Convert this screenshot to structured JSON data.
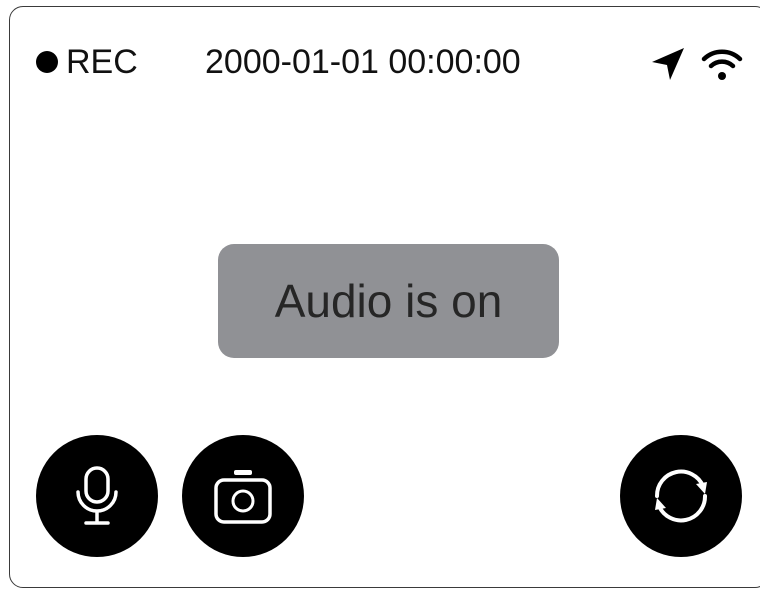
{
  "status_bar": {
    "rec_label": "REC",
    "datetime": "2000-01-01 00:00:00",
    "icons": [
      "location-arrow-icon",
      "wifi-icon"
    ]
  },
  "toast": {
    "message": "Audio is on"
  },
  "controls": {
    "icons": [
      "microphone-icon",
      "camera-icon",
      "switch-camera-icon"
    ]
  },
  "colors": {
    "background": "#ffffff",
    "toast_bg": "#909195",
    "button_bg": "#000000",
    "text": "#111111"
  }
}
